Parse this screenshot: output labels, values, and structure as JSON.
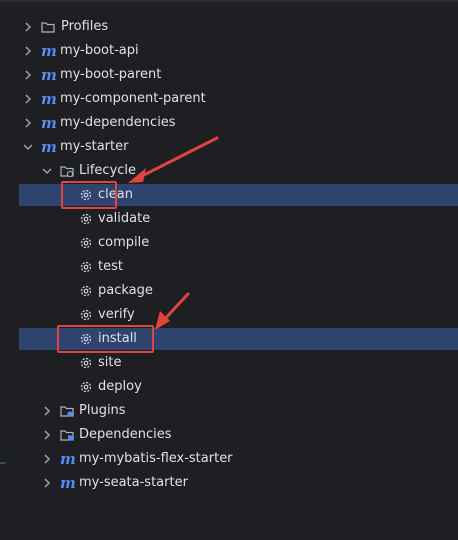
{
  "tree": {
    "nodes": [
      {
        "label": "Profiles",
        "icon": "folder-icon",
        "expand": "collapsed"
      },
      {
        "label": "my-boot-api",
        "icon": "maven-icon",
        "expand": "collapsed"
      },
      {
        "label": "my-boot-parent",
        "icon": "maven-icon",
        "expand": "collapsed"
      },
      {
        "label": "my-component-parent",
        "icon": "maven-icon",
        "expand": "collapsed"
      },
      {
        "label": "my-dependencies",
        "icon": "maven-icon",
        "expand": "collapsed"
      },
      {
        "label": "my-starter",
        "icon": "maven-icon",
        "expand": "expanded"
      },
      {
        "label": "Lifecycle",
        "icon": "lifecycle-folder-icon",
        "expand": "expanded"
      },
      {
        "label": "clean",
        "icon": "gear-icon",
        "selected": true
      },
      {
        "label": "validate",
        "icon": "gear-icon"
      },
      {
        "label": "compile",
        "icon": "gear-icon"
      },
      {
        "label": "test",
        "icon": "gear-icon"
      },
      {
        "label": "package",
        "icon": "gear-icon"
      },
      {
        "label": "verify",
        "icon": "gear-icon"
      },
      {
        "label": "install",
        "icon": "gear-icon",
        "selected": true
      },
      {
        "label": "site",
        "icon": "gear-icon"
      },
      {
        "label": "deploy",
        "icon": "gear-icon"
      },
      {
        "label": "Plugins",
        "icon": "plugins-folder-icon",
        "expand": "collapsed"
      },
      {
        "label": "Dependencies",
        "icon": "dependencies-folder-icon",
        "expand": "collapsed"
      },
      {
        "label": "my-mybatis-flex-starter",
        "icon": "maven-icon",
        "expand": "collapsed"
      },
      {
        "label": "my-seata-starter",
        "icon": "maven-icon",
        "expand": "collapsed"
      }
    ]
  },
  "maven_glyph": "m",
  "colors": {
    "background": "#1e1f22",
    "selection": "#2e436e",
    "highlight_box": "#e0443e",
    "arrow": "#e0443e",
    "maven_icon": "#548af7",
    "text": "#dfe1e5"
  }
}
